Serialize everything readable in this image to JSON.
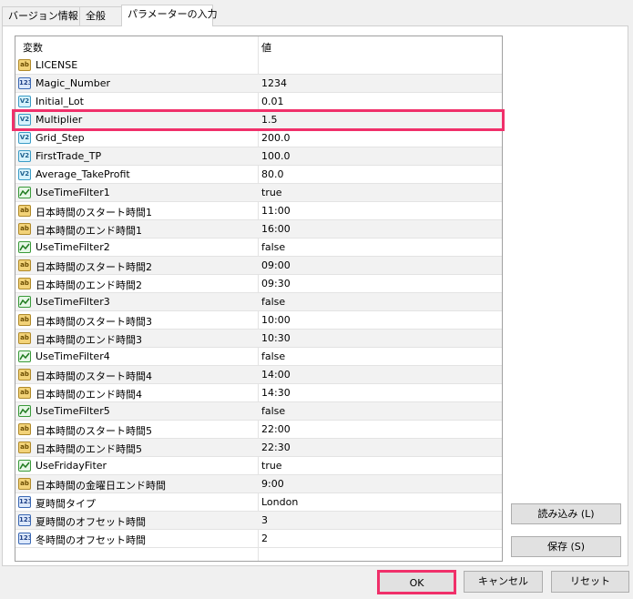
{
  "tabs": [
    {
      "label": "バージョン情報"
    },
    {
      "label": "全般"
    },
    {
      "label": "パラメーターの入力"
    }
  ],
  "table": {
    "headers": {
      "variable": "変数",
      "value": "値"
    },
    "rows": [
      {
        "icon": "ab",
        "name": "LICENSE",
        "value": ""
      },
      {
        "icon": "123",
        "name": "Magic_Number",
        "value": "1234"
      },
      {
        "icon": "V2",
        "name": "Initial_Lot",
        "value": "0.01"
      },
      {
        "icon": "V2",
        "name": "Multiplier",
        "value": "1.5"
      },
      {
        "icon": "V2",
        "name": "Grid_Step",
        "value": "200.0"
      },
      {
        "icon": "V2",
        "name": "FirstTrade_TP",
        "value": "100.0"
      },
      {
        "icon": "V2",
        "name": "Average_TakeProfit",
        "value": "80.0"
      },
      {
        "icon": "bool",
        "name": "UseTimeFilter1",
        "value": "true"
      },
      {
        "icon": "ab",
        "name": "日本時間のスタート時間1",
        "value": "11:00"
      },
      {
        "icon": "ab",
        "name": "日本時間のエンド時間1",
        "value": "16:00"
      },
      {
        "icon": "bool",
        "name": "UseTimeFilter2",
        "value": "false"
      },
      {
        "icon": "ab",
        "name": "日本時間のスタート時間2",
        "value": "09:00"
      },
      {
        "icon": "ab",
        "name": "日本時間のエンド時間2",
        "value": "09:30"
      },
      {
        "icon": "bool",
        "name": "UseTimeFilter3",
        "value": "false"
      },
      {
        "icon": "ab",
        "name": "日本時間のスタート時間3",
        "value": "10:00"
      },
      {
        "icon": "ab",
        "name": "日本時間のエンド時間3",
        "value": "10:30"
      },
      {
        "icon": "bool",
        "name": "UseTimeFilter4",
        "value": "false"
      },
      {
        "icon": "ab",
        "name": "日本時間のスタート時間4",
        "value": "14:00"
      },
      {
        "icon": "ab",
        "name": "日本時間のエンド時間4",
        "value": "14:30"
      },
      {
        "icon": "bool",
        "name": "UseTimeFilter5",
        "value": "false"
      },
      {
        "icon": "ab",
        "name": "日本時間のスタート時間5",
        "value": "22:00"
      },
      {
        "icon": "ab",
        "name": "日本時間のエンド時間5",
        "value": "22:30"
      },
      {
        "icon": "bool",
        "name": "UseFridayFiter",
        "value": "true"
      },
      {
        "icon": "ab",
        "name": "日本時間の金曜日エンド時間",
        "value": "9:00"
      },
      {
        "icon": "123",
        "name": "夏時間タイプ",
        "value": "London"
      },
      {
        "icon": "123",
        "name": "夏時間のオフセット時間",
        "value": "3"
      },
      {
        "icon": "123",
        "name": "冬時間のオフセット時間",
        "value": "2"
      }
    ]
  },
  "buttons": {
    "load": "読み込み (L)",
    "save": "保存 (S)",
    "ok": "OK",
    "cancel": "キャンセル",
    "reset": "リセット"
  },
  "colors": {
    "highlight": "#f0306a"
  }
}
